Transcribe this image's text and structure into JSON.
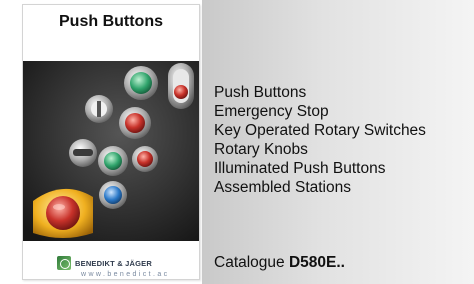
{
  "cover": {
    "title": "Push Buttons",
    "brand": "BENEDIKT & JÄGER",
    "url": "www.benedict.ac"
  },
  "products": [
    "Push Buttons",
    "Emergency Stop",
    "Key Operated Rotary Switches",
    "Rotary Knobs",
    "Illuminated Push Buttons",
    "Assembled Stations"
  ],
  "catalogue": {
    "label": "Catalogue",
    "code": "D580E.."
  },
  "colors": {
    "photo_background": "#2a2a2a",
    "accent_green": "#2fa36b",
    "accent_red": "#c8322a",
    "accent_blue": "#2a78c8",
    "emergency_yellow": "#f0b020"
  }
}
